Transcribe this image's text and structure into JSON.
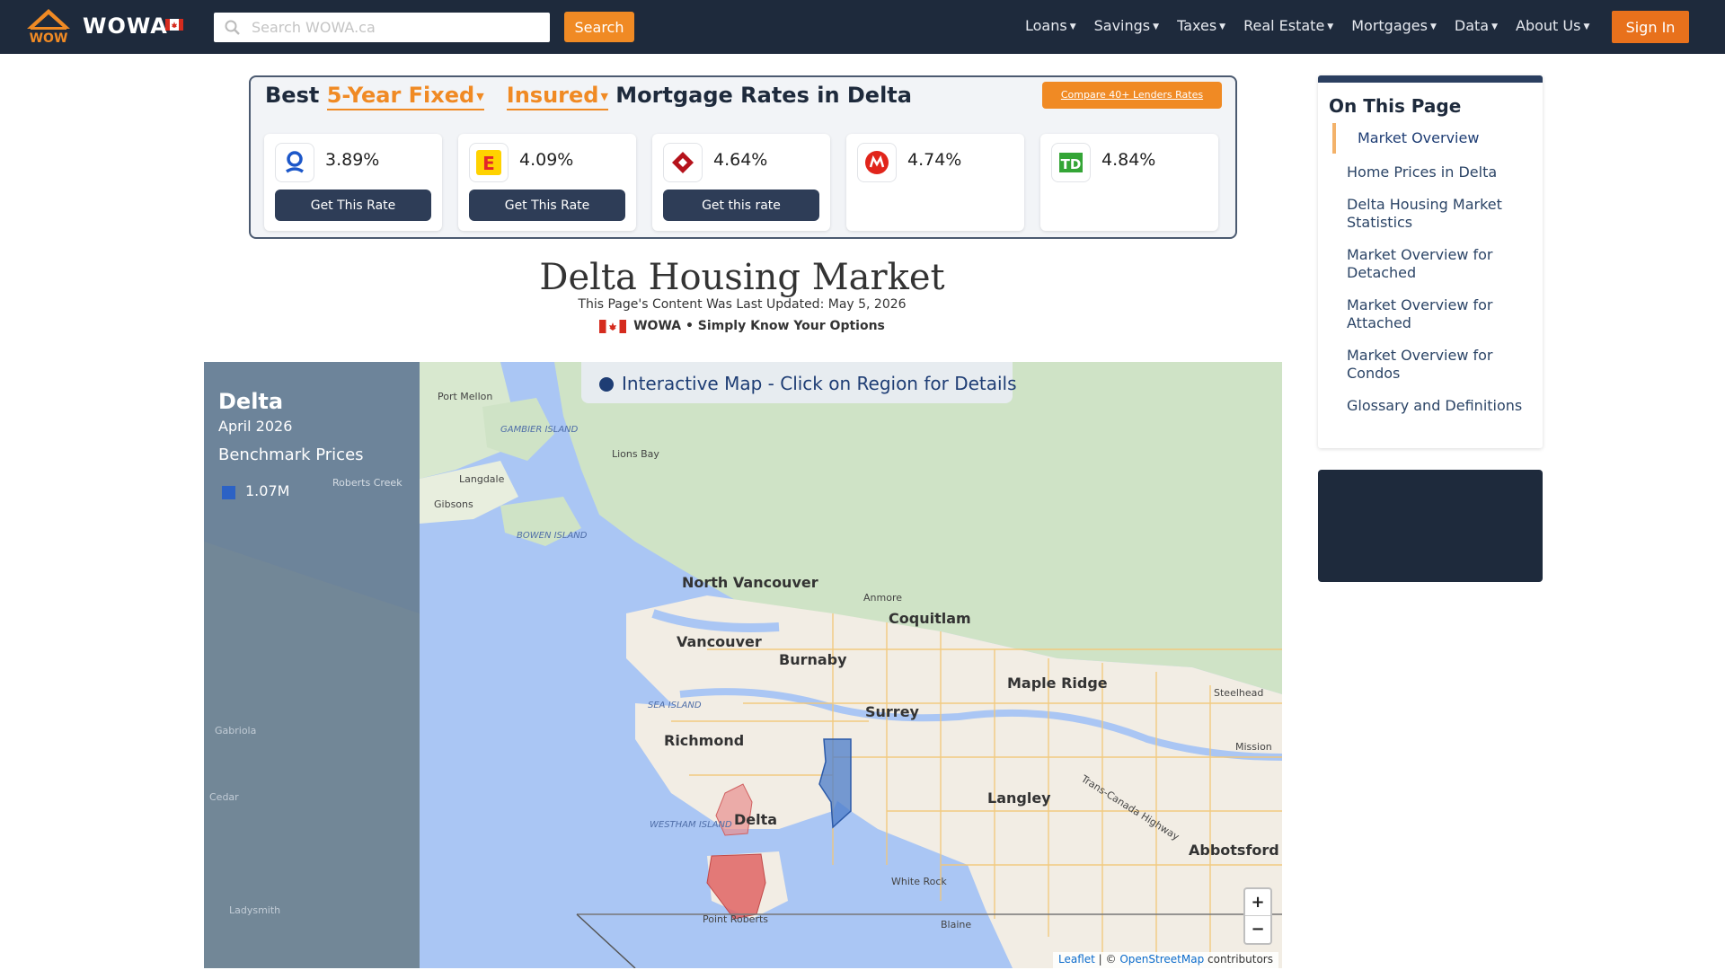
{
  "nav": {
    "brand": "WOWA",
    "search_placeholder": "Search WOWA.ca",
    "search_button": "Search",
    "menu": [
      "Loans",
      "Savings",
      "Taxes",
      "Real Estate",
      "Mortgages",
      "Data",
      "About Us"
    ],
    "signin": "Sign In"
  },
  "rates": {
    "title_prefix": "Best",
    "term_select": "5-Year Fixed",
    "type_select": "Insured",
    "title_suffix": "Mortgage Rates in Delta",
    "compare_button": "Compare 40+ Lenders Rates",
    "cards": [
      {
        "lender_icon": "lender-logo-blue",
        "rate": "3.89%",
        "button": "Get This Rate"
      },
      {
        "lender_icon": "lender-logo-e",
        "rate": "4.09%",
        "button": "Get This Rate"
      },
      {
        "lender_icon": "cibc-logo",
        "rate": "4.64%",
        "button": "Get this rate"
      },
      {
        "lender_icon": "bmo-logo",
        "rate": "4.74%",
        "button": ""
      },
      {
        "lender_icon": "td-logo",
        "rate": "4.84%",
        "button": ""
      }
    ]
  },
  "page": {
    "title": "Delta Housing Market",
    "updated": "This Page's Content Was Last Updated: May 5, 2026",
    "tagline": "WOWA • Simply Know Your Options"
  },
  "map": {
    "banner": "Interactive Map - Click on Region for Details",
    "legend": {
      "city": "Delta",
      "month": "April 2026",
      "heading": "Benchmark Prices",
      "swatch_color": "#2c62c5",
      "price": "1.07M"
    },
    "zoom_in": "+",
    "zoom_out": "−",
    "attribution_leaflet": "Leaflet",
    "attribution_sep": " | © ",
    "attribution_osm": "OpenStreetMap",
    "attribution_suffix": " contributors",
    "labels": {
      "north_vancouver": "North Vancouver",
      "vancouver": "Vancouver",
      "burnaby": "Burnaby",
      "coquitlam": "Coquitlam",
      "maple_ridge": "Maple Ridge",
      "surrey": "Surrey",
      "richmond": "Richmond",
      "delta": "Delta",
      "langley": "Langley",
      "abbotsford": "Abbotsford",
      "white_rock": "White Rock",
      "point_roberts": "Point Roberts",
      "blaine": "Blaine",
      "mission": "Mission",
      "port_mellon": "Port Mellon",
      "lions_bay": "Lions Bay",
      "langdale": "Langdale",
      "gibsons": "Gibsons",
      "anmore": "Anmore",
      "steelhead": "Steelhead",
      "gambier": "GAMBIER ISLAND",
      "bowen": "BOWEN ISLAND",
      "sea_island": "SEA ISLAND",
      "westham": "WESTHAM ISLAND",
      "roberts_creek": "Roberts Creek",
      "gabriola": "Gabriola",
      "ladysmith": "Ladysmith",
      "cedar": "Cedar",
      "trans_canada": "Trans-Canada Highway"
    }
  },
  "toc": {
    "title": "On This Page",
    "items": [
      "Market Overview",
      "Home Prices in Delta",
      "Delta Housing Market Statistics",
      "Market Overview for Detached",
      "Market Overview for Attached",
      "Market Overview for Condos",
      "Glossary and Definitions"
    ]
  }
}
